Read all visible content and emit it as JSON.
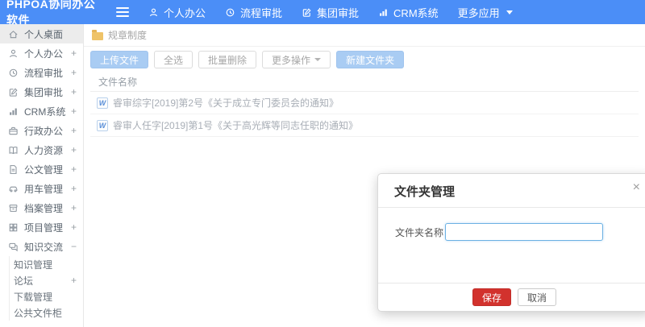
{
  "colors": {
    "navbar_blue": "#4b8ef7",
    "primary_button_blue": "#a9ccf3",
    "save_button_red": "#d2322d",
    "folder_icon_yellow": "#efc368",
    "input_focus_border": "#6cb1e3"
  },
  "navbar": {
    "logo": "PHPOA协同办公软件",
    "items": [
      {
        "label": "个人办公",
        "icon": "user-icon"
      },
      {
        "label": "流程审批",
        "icon": "history-icon"
      },
      {
        "label": "集团审批",
        "icon": "edit-icon"
      },
      {
        "label": "CRM系统",
        "icon": "chart-icon"
      },
      {
        "label": "更多应用",
        "icon": "caret-down-icon"
      }
    ]
  },
  "sidebar": {
    "items": [
      {
        "label": "个人桌面",
        "icon": "home-icon",
        "glyph": "",
        "active": true
      },
      {
        "label": "个人办公",
        "icon": "user-icon",
        "glyph": "+"
      },
      {
        "label": "流程审批",
        "icon": "history-icon",
        "glyph": "+"
      },
      {
        "label": "集团审批",
        "icon": "edit-icon",
        "glyph": "+"
      },
      {
        "label": "CRM系统",
        "icon": "chart-icon",
        "glyph": "+"
      },
      {
        "label": "行政办公",
        "icon": "briefcase-icon",
        "glyph": "+"
      },
      {
        "label": "人力资源",
        "icon": "book-icon",
        "glyph": "+"
      },
      {
        "label": "公文管理",
        "icon": "document-icon",
        "glyph": "+"
      },
      {
        "label": "用车管理",
        "icon": "car-icon",
        "glyph": "+"
      },
      {
        "label": "档案管理",
        "icon": "archive-icon",
        "glyph": "+"
      },
      {
        "label": "项目管理",
        "icon": "grid-icon",
        "glyph": "+"
      },
      {
        "label": "知识交流",
        "icon": "chat-icon",
        "glyph": "−",
        "children": [
          {
            "label": "知识管理",
            "glyph": ""
          },
          {
            "label": "论坛",
            "glyph": "+"
          },
          {
            "label": "下载管理",
            "glyph": ""
          },
          {
            "label": "公共文件柜",
            "glyph": ""
          }
        ]
      }
    ]
  },
  "main": {
    "breadcrumb": "规章制度",
    "toolbar": {
      "upload": "上传文件",
      "select_all": "全选",
      "batch_delete": "批量删除",
      "more_actions": "更多操作",
      "new_folder": "新建文件夹"
    },
    "table": {
      "header": "文件名称",
      "doc_badge": "W",
      "rows": [
        {
          "name": "睿审综字[2019]第2号《关于成立专门委员会的通知》"
        },
        {
          "name": "睿审人任字[2019]第1号《关于高光辉等同志任职的通知》"
        }
      ]
    }
  },
  "modal": {
    "title": "文件夹管理",
    "close": "×",
    "field_label": "文件夹名称",
    "field_value": "",
    "save": "保存",
    "cancel": "取消"
  }
}
